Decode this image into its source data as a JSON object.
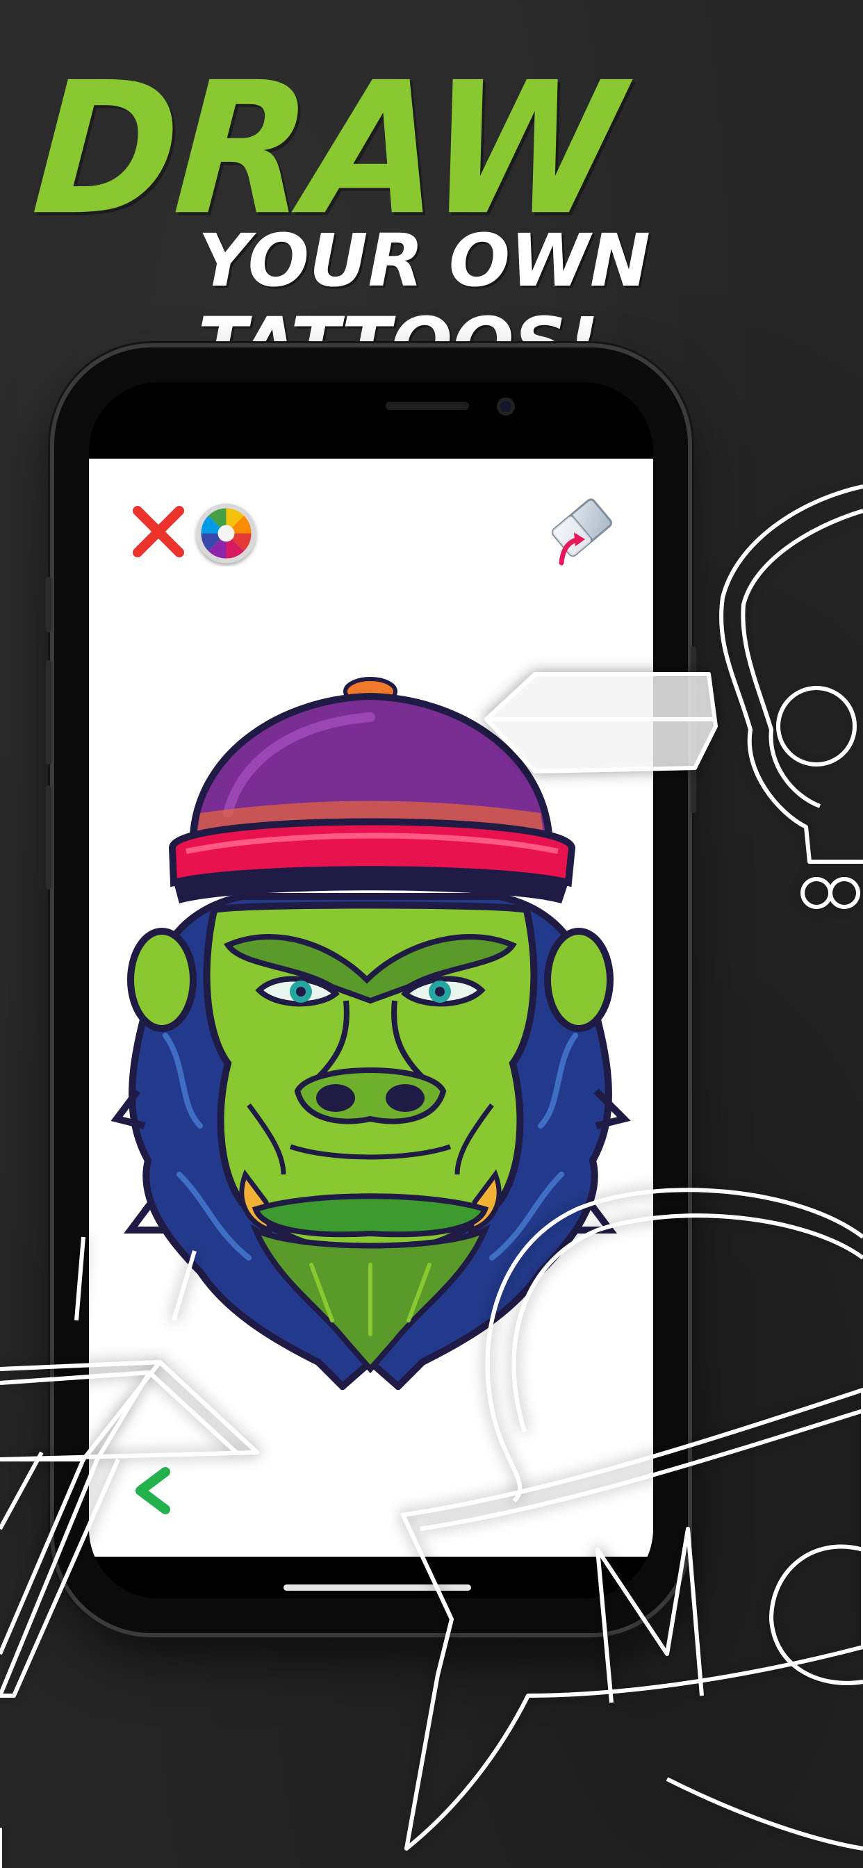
{
  "headline": {
    "main": "DRAW",
    "sub": "YOUR OWN TATTOOS!"
  },
  "colors": {
    "background": "#262626",
    "headline_accent": "#8ac832",
    "close_red": "#e9332b",
    "undo_green": "#23b14d"
  },
  "toolbar": {
    "close_icon": "close-icon",
    "palette_icon": "color-palette-icon",
    "eraser_icon": "eraser-icon",
    "undo_icon": "undo-arrow-icon"
  }
}
